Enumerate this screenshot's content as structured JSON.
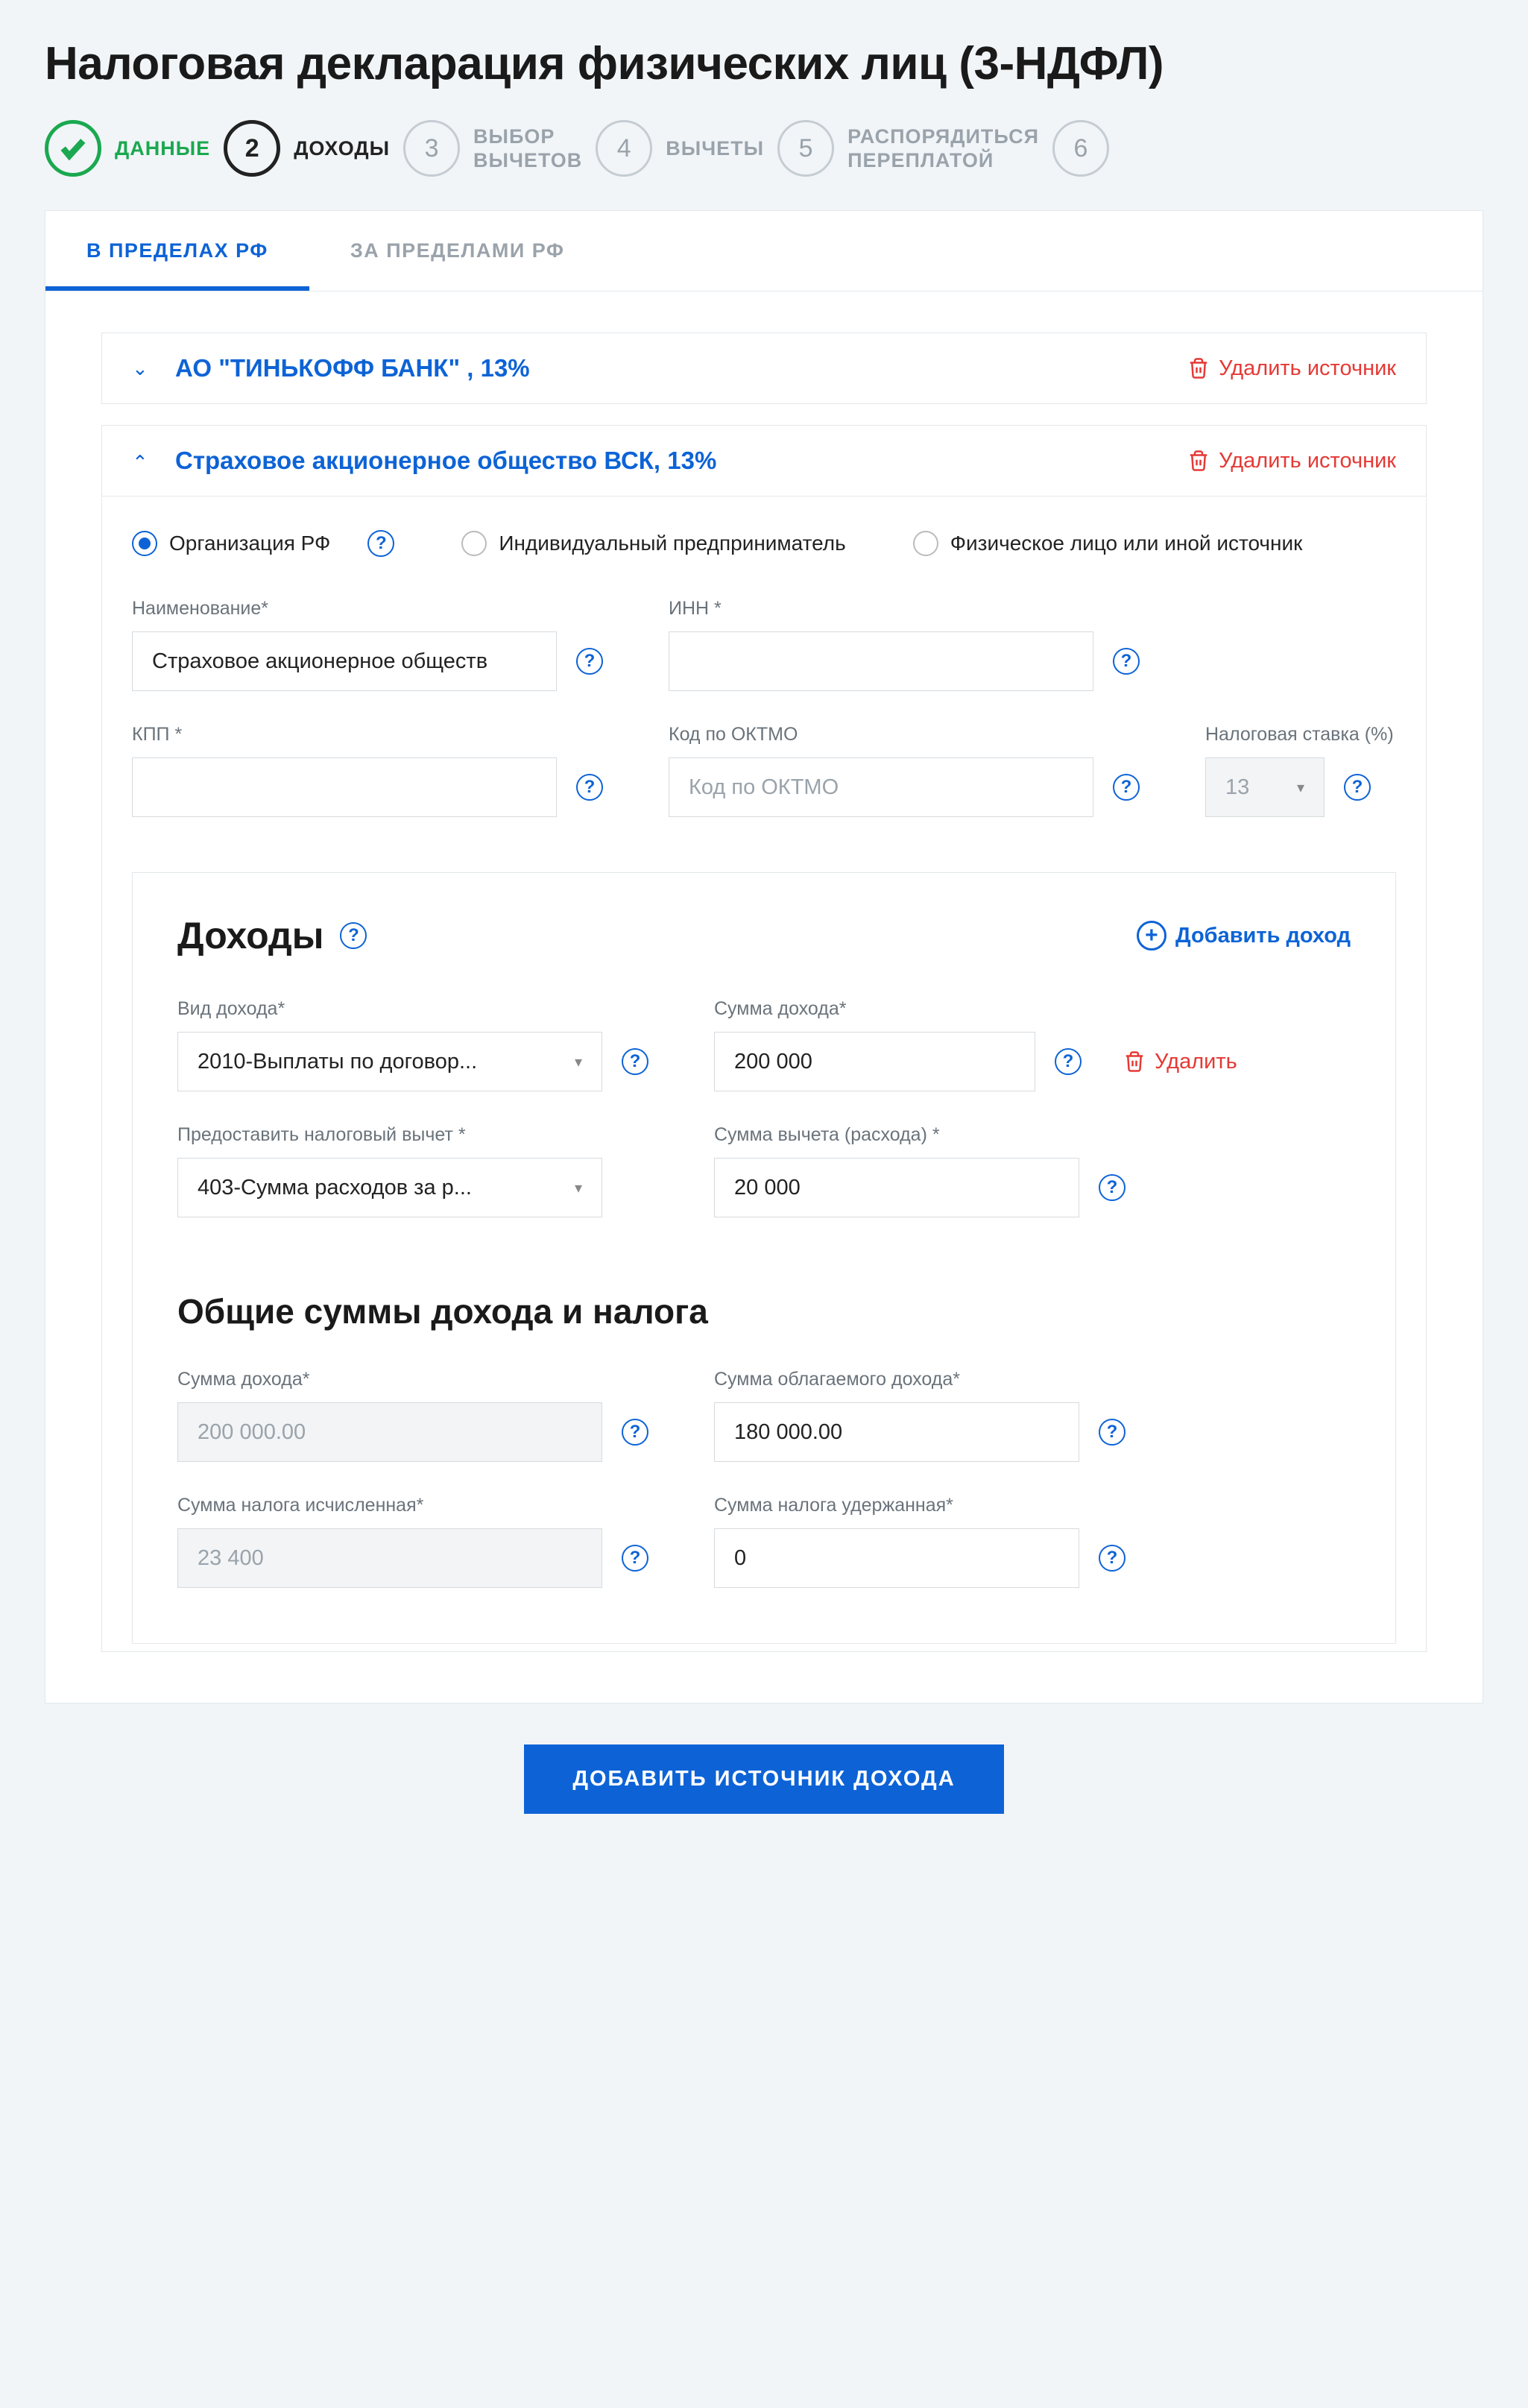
{
  "pageTitle": "Налоговая декларация физических лиц (3-НДФЛ)",
  "steps": [
    {
      "label": "ДАННЫЕ"
    },
    {
      "num": "2",
      "label": "ДОХОДЫ"
    },
    {
      "num": "3",
      "label": "ВЫБОР\nВЫЧЕТОВ"
    },
    {
      "num": "4",
      "label": "ВЫЧЕТЫ"
    },
    {
      "num": "5",
      "label": "РАСПОРЯДИТЬСЯ\nПЕРЕПЛАТОЙ"
    },
    {
      "num": "6",
      "label": ""
    }
  ],
  "tabs": {
    "rf": "В ПРЕДЕЛАХ РФ",
    "abroad": "ЗА ПРЕДЕЛАМИ РФ"
  },
  "source1": {
    "title": "АО \"ТИНЬКОФФ БАНК\" , 13%",
    "deleteLabel": "Удалить источник"
  },
  "source2": {
    "title": "Страховое акционерное общество ВСК, 13%",
    "deleteLabel": "Удалить источник",
    "orgTypes": {
      "org": "Организация РФ",
      "ip": "Индивидуальный предприниматель",
      "phys": "Физическое лицо или иной источник"
    },
    "fields": {
      "nameLabel": "Наименование*",
      "nameValue": "Страховое акционерное обществ",
      "innLabel": "ИНН *",
      "innValue": "██████████",
      "kppLabel": "КПП *",
      "kppValue": "████████",
      "oktmoLabel": "Код по ОКТМО",
      "oktmoPlaceholder": "Код по ОКТМО",
      "rateLabel": "Налоговая ставка (%)",
      "rateValue": "13"
    }
  },
  "income": {
    "sectionTitle": "Доходы",
    "addLabel": "Добавить доход",
    "typeLabel": "Вид дохода*",
    "typeValue": "2010-Выплаты по договор...",
    "amountLabel": "Сумма дохода*",
    "amountValue": "200 000",
    "deleteLabel": "Удалить",
    "deductionLabel": "Предоставить налоговый вычет *",
    "deductionValue": "403-Сумма расходов за р...",
    "dedAmountLabel": "Сумма вычета (расхода) *",
    "dedAmountValue": "20 000"
  },
  "totals": {
    "sectionTitle": "Общие суммы дохода и налога",
    "sumLabel": "Сумма дохода*",
    "sumValue": "200 000.00",
    "taxableLabel": "Сумма облагаемого дохода*",
    "taxableValue": "180 000.00",
    "taxCalcLabel": "Сумма налога исчисленная*",
    "taxCalcValue": "23 400",
    "taxHeldLabel": "Сумма налога удержанная*",
    "taxHeldValue": "0"
  },
  "addSourceButton": "ДОБАВИТЬ ИСТОЧНИК ДОХОДА"
}
